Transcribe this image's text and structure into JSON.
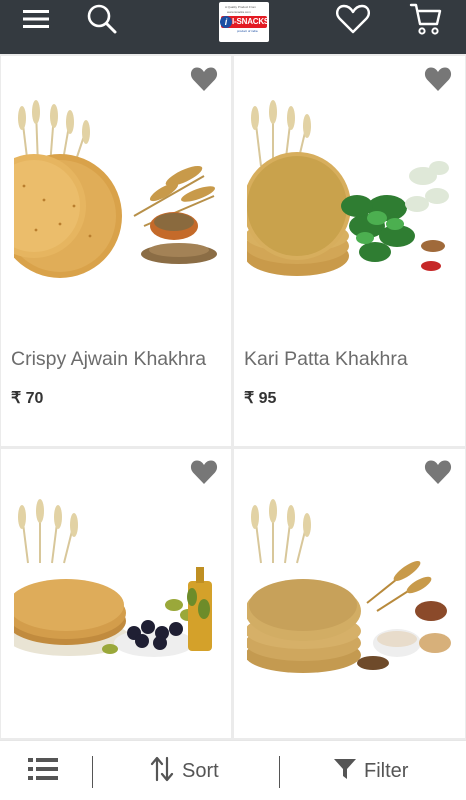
{
  "header": {
    "logo_text": "I-SNACKS",
    "logo_letter": "i",
    "logo_tagline": "A Quality Product From",
    "logo_tagline2": "www.isnacks.com",
    "logo_sub": "product of india"
  },
  "products": [
    {
      "title": "Crispy Ajwain Khakhra",
      "price": "₹ 70",
      "image": "ajwain-khakhra-image"
    },
    {
      "title": "Kari Patta Khakhra",
      "price": "₹ 95",
      "image": "kari-patta-khakhra-image"
    },
    {
      "title": "",
      "price": "",
      "image": "olive-khakhra-image"
    },
    {
      "title": "",
      "price": "",
      "image": "multigrain-khakhra-image"
    }
  ],
  "bottom_bar": {
    "sort_label": "Sort",
    "filter_label": "Filter"
  },
  "colors": {
    "topbar": "#343a40",
    "heart": "#777777"
  },
  "icons": [
    "menu-icon",
    "search-icon",
    "wishlist-icon",
    "cart-icon",
    "heart-icon",
    "list-view-icon",
    "sort-icon",
    "filter-icon"
  ]
}
